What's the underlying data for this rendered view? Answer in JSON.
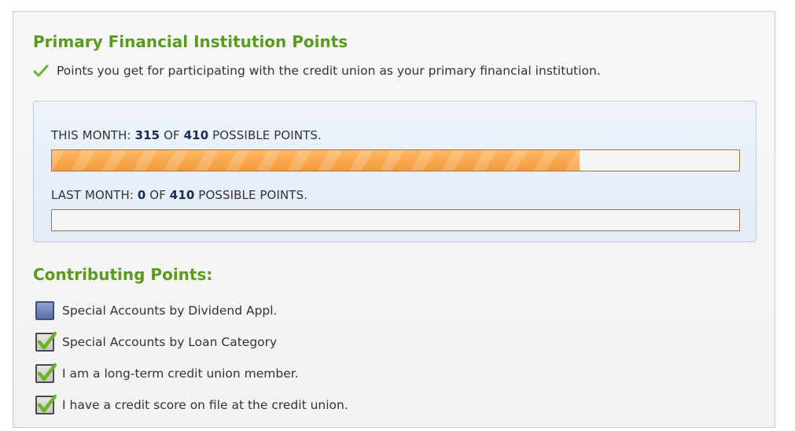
{
  "header": {
    "title": "Primary Financial Institution Points",
    "subtitle": "Points you get for participating with the credit union as your primary financial institution."
  },
  "points": {
    "this_month": {
      "label_prefix": "THIS MONTH:",
      "value": "315",
      "of": "OF",
      "possible": "410",
      "label_suffix": "POSSIBLE POINTS.",
      "progress_fraction": 0.768
    },
    "last_month": {
      "label_prefix": "LAST MONTH:",
      "value": "0",
      "of": "OF",
      "possible": "410",
      "label_suffix": "POSSIBLE POINTS.",
      "progress_fraction": 0
    }
  },
  "contributing": {
    "title": "Contributing Points:",
    "items": [
      {
        "label": "Special Accounts by Dividend Appl.",
        "checked": false
      },
      {
        "label": "Special Accounts by Loan Category",
        "checked": true
      },
      {
        "label": "I am a long-term credit union member.",
        "checked": true
      },
      {
        "label": "I have a credit score on file at the credit union.",
        "checked": true
      }
    ]
  },
  "colors": {
    "accent_green": "#5a9a1e",
    "bar_orange": "#f39a3a",
    "panel_blue": "#e3ebf8"
  }
}
